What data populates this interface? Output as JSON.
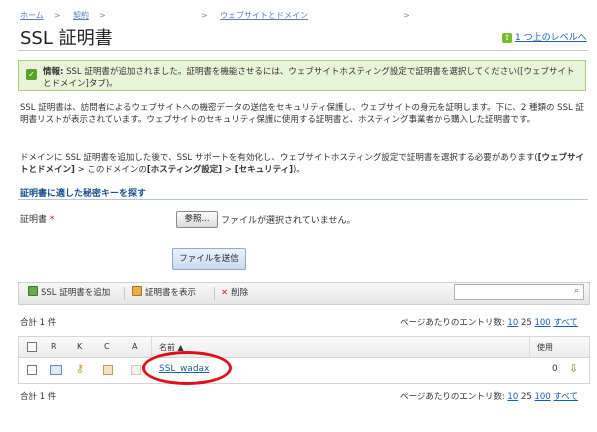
{
  "breadcrumb": {
    "home": "ホーム",
    "sep1": ">",
    "contract": "契約",
    "sep2": ">",
    "websites": "ウェブサイトとドメイン",
    "sep3": ">",
    "sep4": ">"
  },
  "page": {
    "title": "SSL 証明書",
    "up_level": "1 つ上のレベルへ"
  },
  "notice": {
    "label": "情報:",
    "text": "SSL 証明書が追加されました。証明書を機能させるには、ウェブサイトホスティング設定で証明書を選択してください([ウェブサイトとドメイン]タブ)。"
  },
  "description": {
    "para1": "SSL 証明書は、訪問者によるウェブサイトへの機密データの送信をセキュリティ保護し、ウェブサイトの身元を証明します。下に、2 種類の SSL 証明書リストが表示されています。ウェブサイトのセキュリティ保護に使用する証明書と、ホスティング事業者から購入した証明書です。",
    "para2_start": "ドメインに SSL 証明書を追加した後で、SSL サポートを有効化し、ウェブサイトホスティング設定で証明書を選択する必要があります(",
    "para2_b1": "[ウェブサイトとドメイン]",
    "para2_mid": " > このドメインの",
    "para2_b2": "[ホスティング設定]",
    "para2_mid2": " > ",
    "para2_b3": "[セキュリティ]",
    "para2_end": ")。"
  },
  "form": {
    "section_title": "証明書に適した秘密キーを探す",
    "cert_label": "証明書",
    "required_mark": "*",
    "browse_button": "参照...",
    "file_status": "ファイルが選択されていません。",
    "send_button": "ファイルを送信"
  },
  "toolbar": {
    "add": "SSL 証明書を追加",
    "show": "証明書を表示",
    "delete": "削除",
    "search_placeholder": ""
  },
  "list": {
    "total_label": "合計 1 件",
    "per_page_label": "ページあたりのエントリ数:",
    "per_page_options": [
      "10",
      "25",
      "100",
      "すべて"
    ],
    "columns": {
      "r": "R",
      "k": "K",
      "c": "C",
      "a": "A",
      "name": "名前 ▲",
      "usage": "使用"
    },
    "rows": [
      {
        "name": "SSL_wadax",
        "usage": "0"
      }
    ]
  },
  "colors": {
    "link": "#1b5fb2",
    "notice_bg": "#e8f3d8",
    "annotation": "#e0101a"
  }
}
